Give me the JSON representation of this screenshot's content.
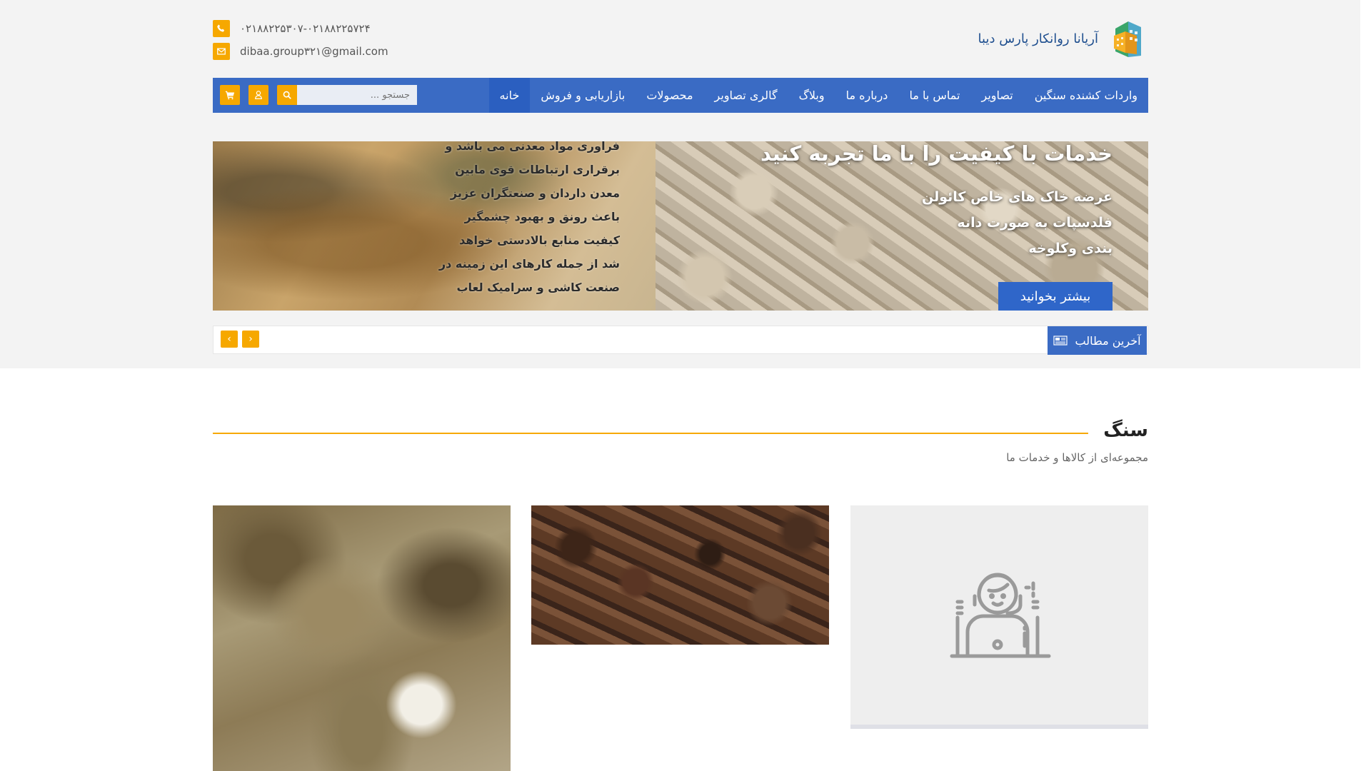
{
  "header": {
    "brand_name": "آریانا روانکار پارس دیبا",
    "phone": "۰۲۱۸۸۲۲۵۳۰۷-۰۲۱۸۸۲۲۵۷۲۴",
    "email": "dibaa.group۳۲۱@gmail.com"
  },
  "nav": {
    "items": [
      {
        "label": "خانه",
        "active": true
      },
      {
        "label": "بازاریابی و فروش"
      },
      {
        "label": "محصولات"
      },
      {
        "label": "گالری تصاویر"
      },
      {
        "label": "وبلاگ"
      },
      {
        "label": "درباره ما"
      },
      {
        "label": "تماس با ما"
      },
      {
        "label": "تصاویر"
      },
      {
        "label": "واردات کشنده سنگین"
      }
    ],
    "search_placeholder": "جستجو ..."
  },
  "slider": {
    "left_lines": [
      "فرآوری مواد معدنی می باشد و",
      "برقراری ارتباطات قوی مابین",
      "معدن داردان و صنعتگران عزیز",
      "باعث رونق و بهبود چشمگیر",
      "کیفیت منابع بالادستی خواهد",
      "شد از جمله کارهای این زمینه در",
      "صنعت کاشی و سرامیک لعاب"
    ],
    "headline": "خدمات با کیفیت را با ما تجربه کنید",
    "features": [
      "عرضه خاک های خاص کائولن",
      "فلدسپات به صورت دانه",
      "بندی وکلوخه"
    ],
    "more_label": "بیشتر بخوانید"
  },
  "ticker": {
    "label": "آخرین مطالب",
    "prev": "‹",
    "next": "›"
  },
  "section": {
    "title": "سنگ",
    "subtitle": "مجموعه‌ای از کالاها و خدمات ما"
  },
  "colors": {
    "accent": "#f6a800",
    "nav_bg": "#3a6bc4",
    "nav_active": "#2b5fc0"
  }
}
